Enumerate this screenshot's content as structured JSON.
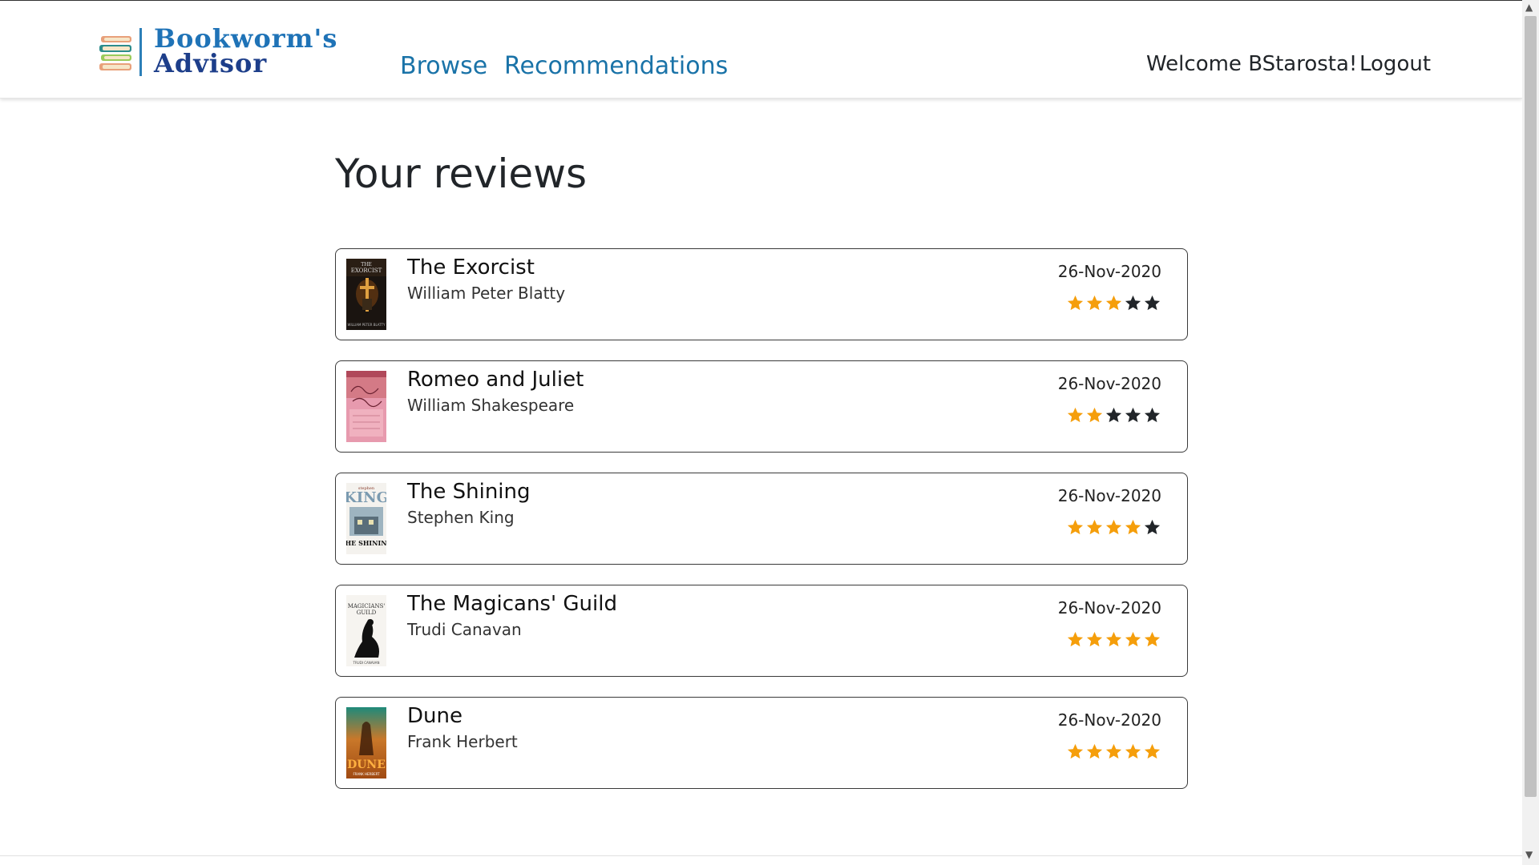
{
  "brand": {
    "line1": "Bookworm's",
    "line2": "Advisor",
    "logo_icon": "stacked-books-icon"
  },
  "nav": {
    "browse": "Browse",
    "recommendations": "Recommendations"
  },
  "user": {
    "welcome": "Welcome BStarosta!",
    "logout": "Logout"
  },
  "page_title": "Your reviews",
  "colors": {
    "accent": "#1a73a8",
    "star_filled": "#f59e0b",
    "star_empty": "#212529"
  },
  "reviews": [
    {
      "title": "The Exorcist",
      "author": "William Peter Blatty",
      "date": "26-Nov-2020",
      "rating": 3,
      "max_rating": 5
    },
    {
      "title": "Romeo and Juliet",
      "author": "William Shakespeare",
      "date": "26-Nov-2020",
      "rating": 2,
      "max_rating": 5
    },
    {
      "title": "The Shining",
      "author": "Stephen King",
      "date": "26-Nov-2020",
      "rating": 4,
      "max_rating": 5
    },
    {
      "title": "The Magicans' Guild",
      "author": "Trudi Canavan",
      "date": "26-Nov-2020",
      "rating": 5,
      "max_rating": 5
    },
    {
      "title": "Dune",
      "author": "Frank Herbert",
      "date": "26-Nov-2020",
      "rating": 5,
      "max_rating": 5
    }
  ]
}
